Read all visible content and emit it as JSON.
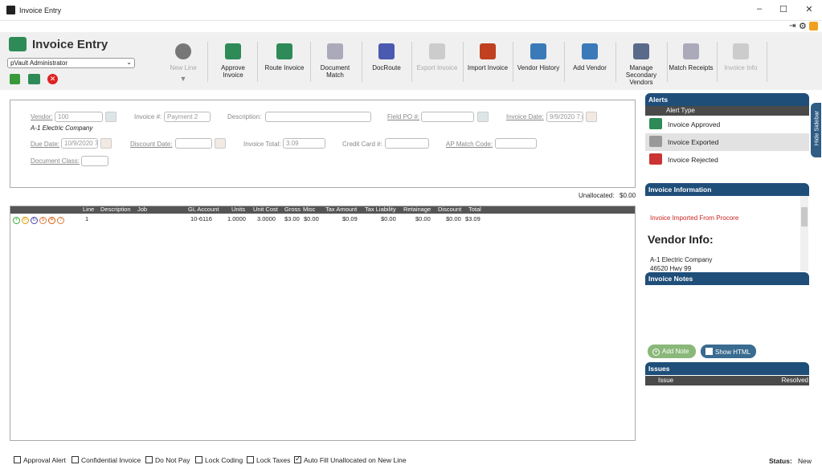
{
  "window": {
    "title": "Invoice Entry",
    "minimize": "–",
    "maximize": "☐",
    "close": "✕"
  },
  "header": {
    "title": "Invoice Entry",
    "user": "pVault Administrator"
  },
  "toolbar": {
    "new_line": "New Line",
    "approve_invoice": "Approve Invoice",
    "route_invoice": "Route Invoice",
    "document_match": "Document Match",
    "docroute": "DocRoute",
    "export_invoice": "Export Invoice",
    "import_invoice": "Import Invoice",
    "vendor_history": "Vendor History",
    "add_vendor": "Add Vendor",
    "manage_secondary_vendors": "Manage Secondary Vendors",
    "match_receipts": "Match Receipts",
    "invoice_info": "Invoice Info"
  },
  "form": {
    "vendor_label": "Vendor:",
    "vendor_value": "100",
    "vendor_name": "A-1 Electric Company",
    "invoice_no_label": "Invoice #:",
    "invoice_no_value": "Payment 2",
    "description_label": "Description:",
    "description_value": "",
    "field_po_label": "Field PO #:",
    "field_po_value": "",
    "invoice_date_label": "Invoice Date:",
    "invoice_date_value": "9/9/2020 7:(",
    "due_date_label": "Due Date:",
    "due_date_value": "10/9/2020 7:",
    "discount_date_label": "Discount Date:",
    "discount_date_value": "",
    "invoice_total_label": "Invoice Total:",
    "invoice_total_value": "3.09",
    "credit_card_label": "Credit Card #:",
    "credit_card_value": "",
    "ap_match_label": "AP Match Code:",
    "ap_match_value": "",
    "doc_class_label": "Document Class:",
    "doc_class_value": ""
  },
  "unallocated": {
    "label": "Unallocated:",
    "value": "$0.00"
  },
  "grid": {
    "columns": [
      "Line",
      "Description",
      "Job",
      "GL Account",
      "Units",
      "Unit Cost",
      "Gross",
      "Misc",
      "Tax Amount",
      "Tax Liability",
      "Retainage",
      "Discount",
      "Total"
    ],
    "rows": [
      {
        "line": "1",
        "description": "",
        "job": "",
        "gl_account": "10-6116",
        "units": "1.0000",
        "unit_cost": "3.0000",
        "gross": "$3.00",
        "misc": "$0.00",
        "tax_amount": "$0.09",
        "tax_liability": "$0.00",
        "retainage": "$0.00",
        "discount": "$0.00",
        "total": "$3.09"
      }
    ]
  },
  "sidebar": {
    "hide_label": "Hide Sidebar",
    "alerts_title": "Alerts",
    "alerts_col": "Alert Type",
    "alerts": [
      "Invoice Approved",
      "Invoice Exported",
      "Invoice Rejected"
    ],
    "info_title": "Invoice Information",
    "info_imported": "Invoice Imported From Procore",
    "vendor_info_title": "Vendor Info:",
    "vendor_info_name": "A-1 Electric Company",
    "vendor_info_addr": "46520 Hwy 99",
    "notes_title": "Invoice Notes",
    "add_note": "Add Note",
    "show_html": "Show HTML",
    "issues_title": "Issues",
    "issues_col_issue": "Issue",
    "issues_col_resolved": "Resolved"
  },
  "options": {
    "approval_alert": "Approval Alert",
    "confidential": "Confidential Invoice",
    "do_not_pay": "Do Not Pay",
    "lock_coding": "Lock Coding",
    "lock_taxes": "Lock Taxes",
    "auto_fill": "Auto Fill Unallocated on New Line"
  },
  "status": {
    "label": "Status:",
    "value": "New"
  },
  "colors": {
    "accent": "#1f4e79",
    "header_dark": "#4a4a4a",
    "link_gray": "#888888",
    "error": "#cc2222"
  }
}
